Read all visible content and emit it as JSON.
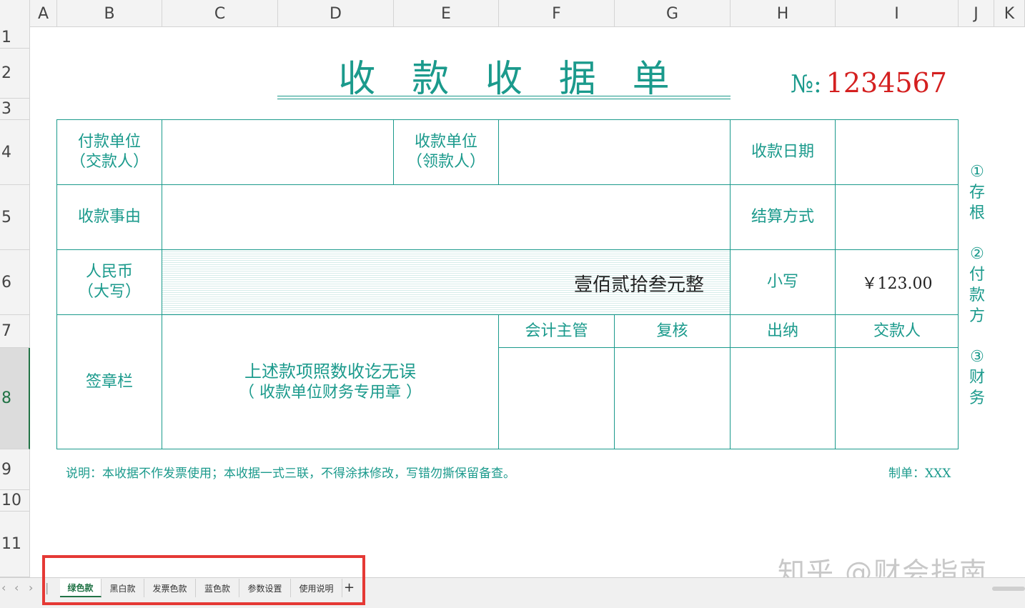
{
  "columns": [
    "A",
    "B",
    "C",
    "D",
    "E",
    "F",
    "G",
    "H",
    "I",
    "J",
    "K"
  ],
  "rows": [
    "1",
    "2",
    "3",
    "4",
    "5",
    "6",
    "7",
    "8",
    "9",
    "10",
    "11"
  ],
  "selected_row": "8",
  "title_chars": [
    "收",
    "款",
    "收",
    "据",
    "单"
  ],
  "serial": {
    "prefix": "№:",
    "number": "1234567"
  },
  "labels": {
    "payer_line1": "付款单位",
    "payer_line2": "（交款人）",
    "payee_line1": "收款单位",
    "payee_line2": "（领款人）",
    "date": "收款日期",
    "reason": "收款事由",
    "settlement": "结算方式",
    "rmb_line1": "人民币",
    "rmb_line2": "（大写）",
    "lowercase": "小写",
    "seal": "签章栏",
    "accounting_supervisor": "会计主管",
    "review": "复核",
    "cashier": "出纳",
    "payer_person": "交款人",
    "confirm_line1": "上述款项照数收讫无误",
    "confirm_line2": "（  收款单位财务专用章  ）"
  },
  "amount_words": "壹佰贰拾叁元整",
  "amount_number": "￥123.00",
  "side_notes": [
    {
      "num": "①",
      "text": [
        "存",
        "根"
      ]
    },
    {
      "num": "②",
      "text": [
        "付",
        "款",
        "方"
      ]
    },
    {
      "num": "③",
      "text": [
        "财",
        "务"
      ]
    }
  ],
  "footnote": "说明：本收据不作发票使用；本收据一式三联，不得涂抹修改，写错勿撕保留备查。",
  "maker": "制单：XXX",
  "watermark": "知乎 @财会指南",
  "sheet_tabs": [
    "绿色款",
    "黑白款",
    "发票色款",
    "蓝色款",
    "参数设置",
    "使用说明"
  ],
  "active_tab": "绿色款",
  "add_sheet": "+",
  "colors": {
    "theme": "#1b9a8c",
    "serial": "#d42020",
    "highlight": "#e53935",
    "active_tab": "#217346"
  }
}
